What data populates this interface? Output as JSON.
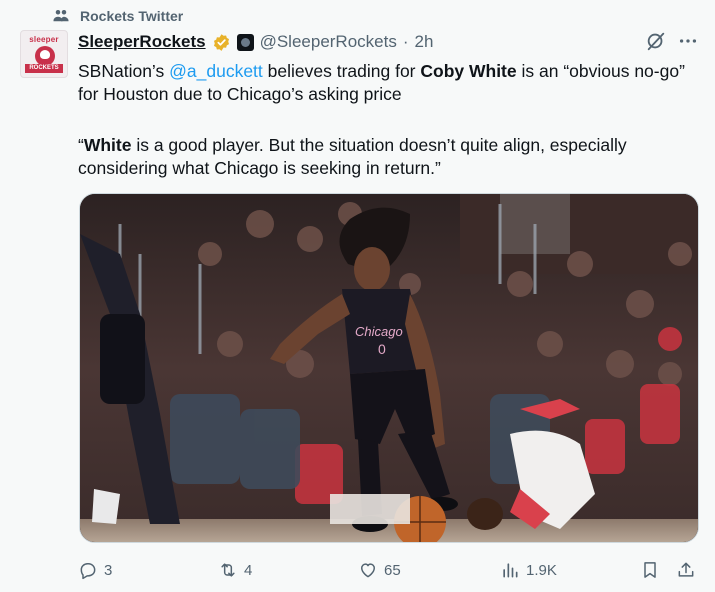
{
  "context": {
    "label": "Rockets Twitter"
  },
  "author": {
    "avatar_top": "sleeper",
    "avatar_bottom": "ROCKETS",
    "name": "SleeperRockets",
    "handle": "@SleeperRockets",
    "separator": "·",
    "time": "2h"
  },
  "body": {
    "p1_pre": "SBNation’s ",
    "p1_mention": "@a_duckett",
    "p1_mid": " believes trading for ",
    "p1_bold": "Coby White",
    "p1_post": " is an “obvious no-go” for Houston due to Chicago’s asking price",
    "p2_pre": "“",
    "p2_bold": "White",
    "p2_post": " is a good player. But the situation doesn’t quite align, especially considering what Chicago is seeking in return.”"
  },
  "media": {
    "jersey_text": "Chicago",
    "jersey_number": "0"
  },
  "actions": {
    "replies": "3",
    "reposts": "4",
    "likes": "65",
    "views": "1.9K"
  },
  "colors": {
    "accent": "#1d9bf0",
    "muted": "#536471",
    "verified_gold": "#e8b22a"
  }
}
